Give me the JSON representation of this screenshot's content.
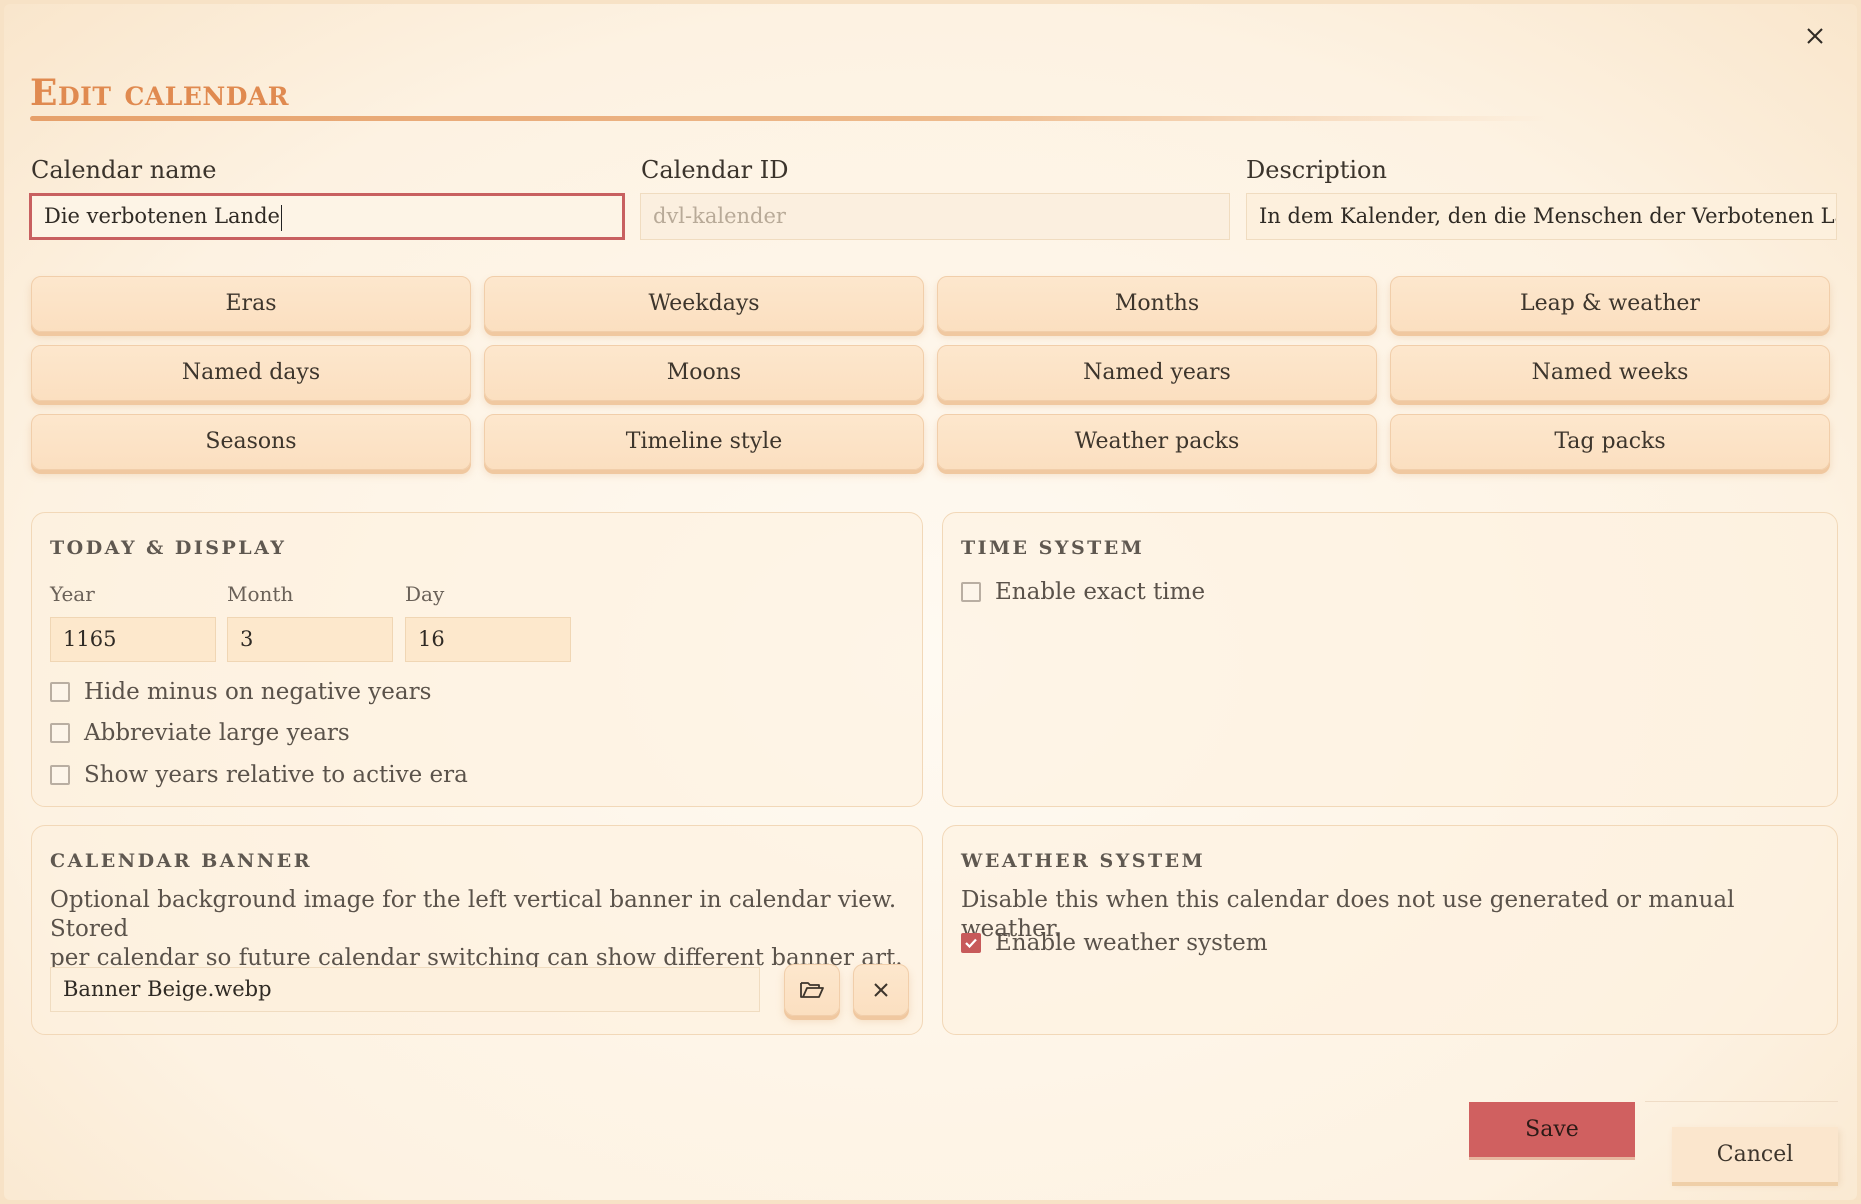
{
  "dialog": {
    "title": "Edit calendar",
    "close_icon": "close-icon"
  },
  "fields": {
    "name_label": "Calendar name",
    "name_value": "Die verbotenen Lande",
    "id_label": "Calendar ID",
    "id_value": "dvl-kalender",
    "description_label": "Description",
    "description_value": "In dem Kalender, den die Menschen der Verbotenen Lanc"
  },
  "tabs": [
    {
      "label": "Eras"
    },
    {
      "label": "Weekdays"
    },
    {
      "label": "Months"
    },
    {
      "label": "Leap & weather"
    },
    {
      "label": "Named days"
    },
    {
      "label": "Moons"
    },
    {
      "label": "Named years"
    },
    {
      "label": "Named weeks"
    },
    {
      "label": "Seasons"
    },
    {
      "label": "Timeline style"
    },
    {
      "label": "Weather packs"
    },
    {
      "label": "Tag packs"
    }
  ],
  "today_display": {
    "title": "TODAY & DISPLAY",
    "year_label": "Year",
    "year_value": "1165",
    "month_label": "Month",
    "month_value": "3",
    "day_label": "Day",
    "day_value": "16",
    "options": [
      {
        "label": "Hide minus on negative years",
        "checked": false
      },
      {
        "label": "Abbreviate large years",
        "checked": false
      },
      {
        "label": "Show years relative to active era",
        "checked": false
      }
    ]
  },
  "time_system": {
    "title": "TIME SYSTEM",
    "exact_time_label": "Enable exact time",
    "exact_time_checked": false
  },
  "calendar_banner": {
    "title": "CALENDAR BANNER",
    "description_line1": "Optional background image for the left vertical banner in calendar view. Stored",
    "description_line2": "per calendar so future calendar switching can show different banner art.",
    "file_value": "Banner Beige.webp"
  },
  "weather_system": {
    "title": "WEATHER SYSTEM",
    "description": "Disable this when this calendar does not use generated or manual weather.",
    "enable_label": "Enable weather system",
    "enable_checked": true
  },
  "footer": {
    "save_label": "Save",
    "cancel_label": "Cancel"
  },
  "colors": {
    "accent": "#e08a50",
    "danger": "#d06060",
    "background": "#fdf2e2"
  }
}
